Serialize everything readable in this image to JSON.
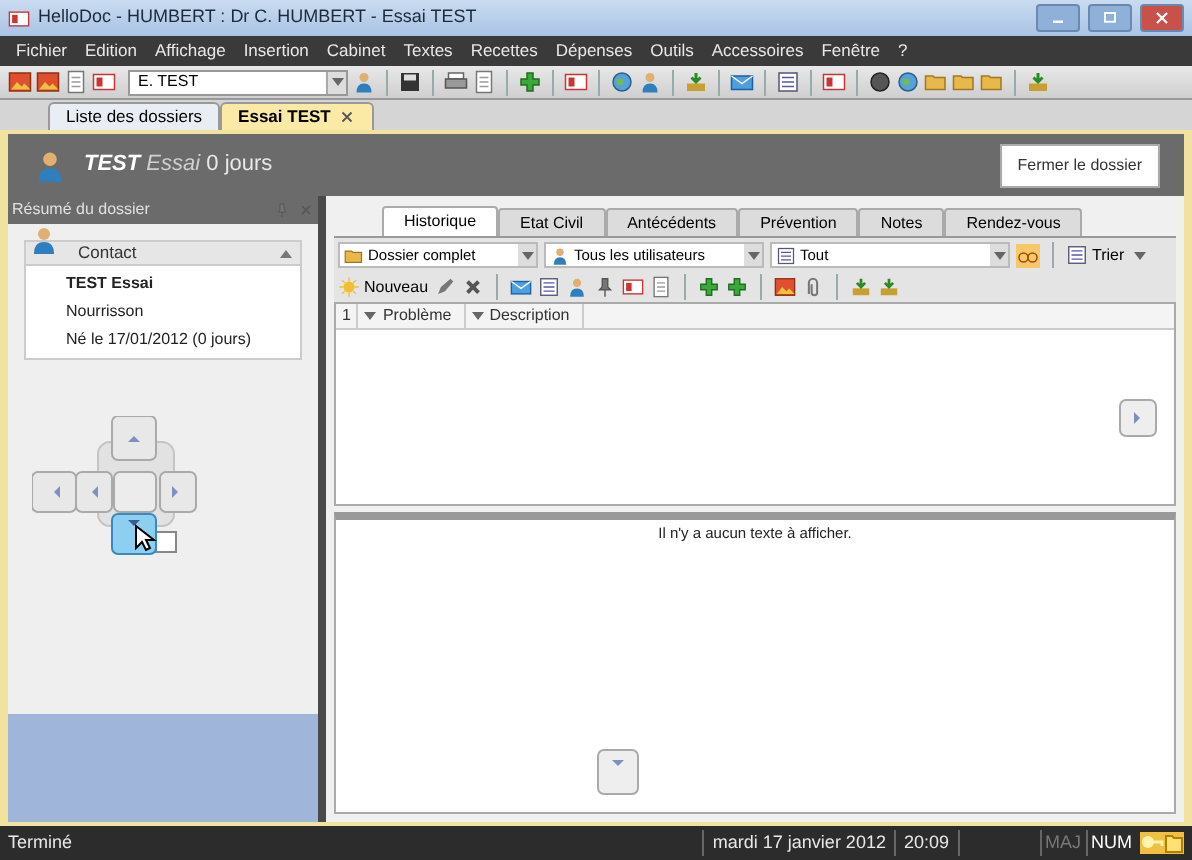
{
  "window": {
    "title": "HelloDoc - HUMBERT : Dr C. HUMBERT - Essai TEST"
  },
  "menu": [
    "Fichier",
    "Edition",
    "Affichage",
    "Insertion",
    "Cabinet",
    "Textes",
    "Recettes",
    "Dépenses",
    "Outils",
    "Accessoires",
    "Fenêtre",
    "?"
  ],
  "toolbar": {
    "patient_combo": "E. TEST"
  },
  "document_tabs": [
    {
      "label": "Liste des dossiers",
      "selected": false,
      "closable": false
    },
    {
      "label": "Essai TEST",
      "selected": true,
      "closable": true
    }
  ],
  "patient_header": {
    "last_name": "TEST",
    "first_name": "Essai",
    "age": "0 jours",
    "close_button": "Fermer le dossier"
  },
  "summary_panel": {
    "title": "Résumé du dossier",
    "section": "Contact",
    "expanded": true,
    "lines": [
      {
        "text": "TEST Essai",
        "bold": true
      },
      {
        "text": "Nourrisson",
        "bold": false
      },
      {
        "text": "Né le 17/01/2012 (0 jours)",
        "bold": false
      }
    ]
  },
  "tabs": [
    {
      "label": "Historique",
      "selected": true
    },
    {
      "label": "Etat Civil",
      "selected": false
    },
    {
      "label": "Antécédents",
      "selected": false
    },
    {
      "label": "Prévention",
      "selected": false
    },
    {
      "label": "Notes",
      "selected": false
    },
    {
      "label": "Rendez-vous",
      "selected": false
    }
  ],
  "filters": {
    "scope": "Dossier complet",
    "users": "Tous les utilisateurs",
    "type": "Tout",
    "sort_button": "Trier"
  },
  "actions": {
    "new_button": "Nouveau"
  },
  "table": {
    "sort_indicator": "1",
    "columns": [
      "Problème",
      "Description"
    ]
  },
  "text_pane": {
    "message": "Il n'y a aucun texte à afficher."
  },
  "status_bar": {
    "message": "Terminé",
    "date": "mardi 17 janvier 2012",
    "time": "20:09",
    "indicators": [
      {
        "label": "MAJ",
        "on": false
      },
      {
        "label": "NUM",
        "on": true
      }
    ]
  }
}
